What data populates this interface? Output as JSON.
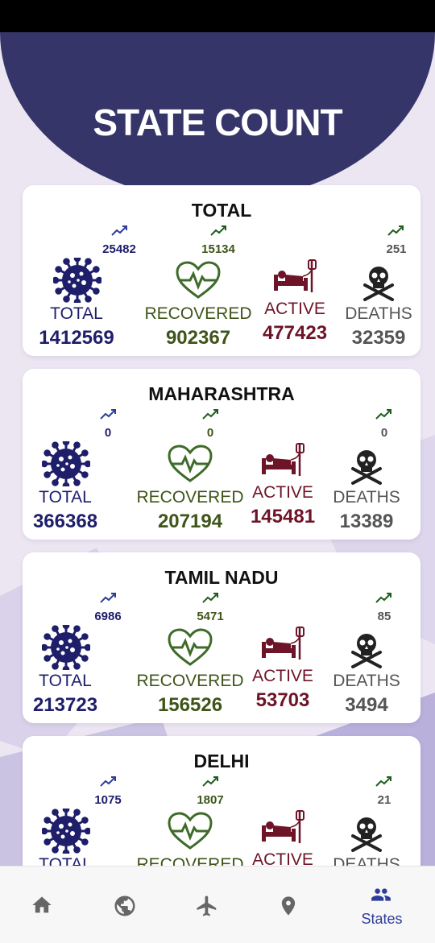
{
  "title": "STATE COUNT",
  "colors": {
    "header": "#353569",
    "total": "#1e1e6b",
    "recovered": "#3f5418",
    "active": "#6d1428",
    "deaths": "#555555"
  },
  "labels": {
    "total": "TOTAL",
    "recovered": "RECOVERED",
    "active": "ACTIVE",
    "deaths": "DEATHS"
  },
  "cards": [
    {
      "name": "TOTAL",
      "total_inc": "25482",
      "recovered_inc": "15134",
      "deaths_inc": "251",
      "total": "1412569",
      "recovered": "902367",
      "active": "477423",
      "deaths": "32359"
    },
    {
      "name": "MAHARASHTRA",
      "total_inc": "0",
      "recovered_inc": "0",
      "deaths_inc": "0",
      "total": "366368",
      "recovered": "207194",
      "active": "145481",
      "deaths": "13389"
    },
    {
      "name": "TAMIL NADU",
      "total_inc": "6986",
      "recovered_inc": "5471",
      "deaths_inc": "85",
      "total": "213723",
      "recovered": "156526",
      "active": "53703",
      "deaths": "3494"
    },
    {
      "name": "DELHI",
      "total_inc": "1075",
      "recovered_inc": "1807",
      "deaths_inc": "21",
      "total": "",
      "recovered": "",
      "active": "",
      "deaths": ""
    }
  ],
  "nav": {
    "items": [
      {
        "icon": "home-icon"
      },
      {
        "icon": "globe-icon"
      },
      {
        "icon": "airplane-icon"
      },
      {
        "icon": "location-pin-icon"
      },
      {
        "icon": "people-icon",
        "label": "States",
        "active": true
      }
    ]
  }
}
